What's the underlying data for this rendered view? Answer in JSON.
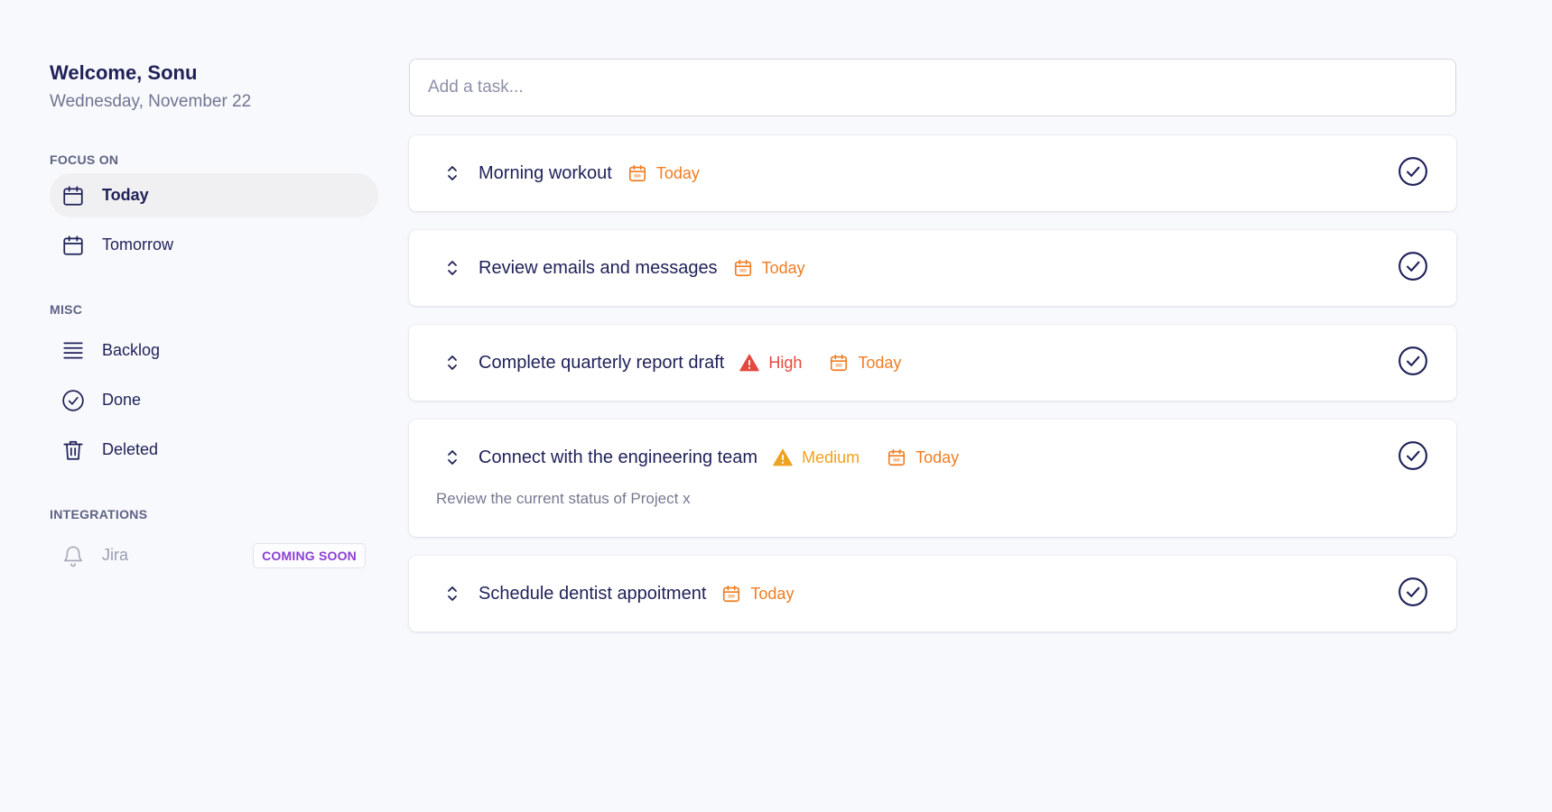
{
  "header": {
    "welcome": "Welcome, Sonu",
    "date": "Wednesday, November 22"
  },
  "sidebar": {
    "focus": {
      "title": "FOCUS ON",
      "items": [
        {
          "label": "Today",
          "icon": "calendar-icon",
          "active": true
        },
        {
          "label": "Tomorrow",
          "icon": "calendar-icon",
          "active": false
        }
      ]
    },
    "misc": {
      "title": "MISC",
      "items": [
        {
          "label": "Backlog",
          "icon": "list-icon"
        },
        {
          "label": "Done",
          "icon": "check-circle-icon"
        },
        {
          "label": "Deleted",
          "icon": "trash-icon"
        }
      ]
    },
    "integrations": {
      "title": "INTEGRATIONS",
      "items": [
        {
          "label": "Jira",
          "icon": "bell-icon",
          "badge": "COMING SOON"
        }
      ]
    }
  },
  "task_input": {
    "placeholder": "Add a task..."
  },
  "tasks": [
    {
      "title": "Morning workout",
      "due": "Today"
    },
    {
      "title": "Review emails and messages",
      "due": "Today"
    },
    {
      "title": "Complete quarterly report draft",
      "priority": "High",
      "due": "Today"
    },
    {
      "title": "Connect with the engineering team",
      "priority": "Medium",
      "due": "Today",
      "description": "Review the current status of Project x"
    },
    {
      "title": "Schedule dentist appoitment",
      "due": "Today"
    }
  ],
  "colors": {
    "text_primary": "#1f2158",
    "due_today": "#f07d22",
    "priority_high": "#e5493e",
    "priority_medium": "#f0a221",
    "coming_soon": "#8b3fd1"
  }
}
